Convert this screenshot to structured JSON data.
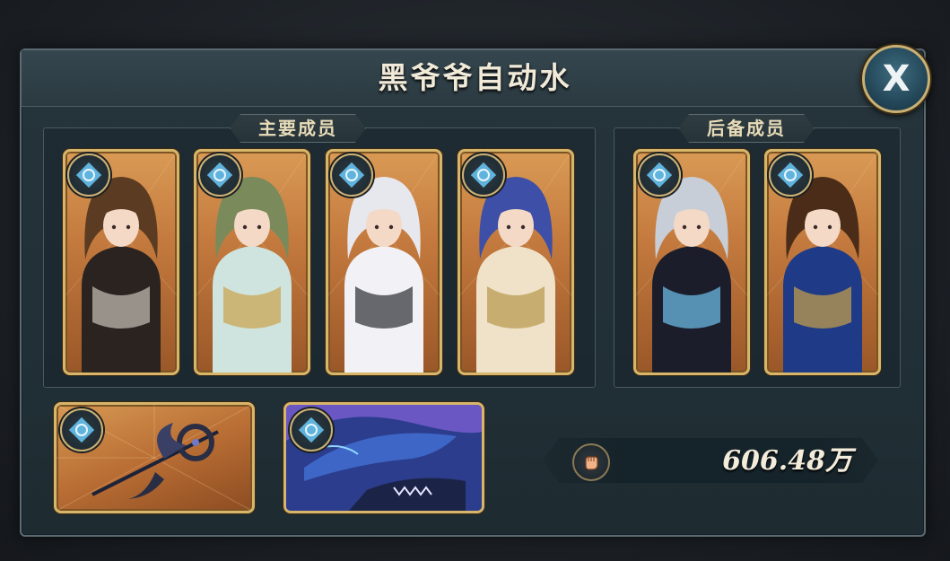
{
  "title": "黑爷爷自动水",
  "close_label": "X",
  "main_group": {
    "label": "主要成员",
    "members": [
      {
        "name": "brown-hair-knight-girl",
        "hair": "#5b3b22",
        "outfit": "#2a2320",
        "accent": "#c9c2b8"
      },
      {
        "name": "elf-green-hair-girl",
        "hair": "#7a8a5a",
        "outfit": "#cfe4df",
        "accent": "#c9a24a"
      },
      {
        "name": "white-hair-girl",
        "hair": "#e7e7ee",
        "outfit": "#f2f1f6",
        "accent": "#2c2c34"
      },
      {
        "name": "blue-hair-girl",
        "hair": "#3d4fa6",
        "outfit": "#efe2c8",
        "accent": "#b8974c"
      }
    ]
  },
  "reserve_group": {
    "label": "后备成员",
    "members": [
      {
        "name": "silver-hair-woman",
        "hair": "#c8ced8",
        "outfit": "#1b1d2b",
        "accent": "#6fc3f0"
      },
      {
        "name": "brown-hair-man",
        "hair": "#4a2c18",
        "outfit": "#1f3a86",
        "accent": "#c9a24a"
      }
    ]
  },
  "equipment": [
    {
      "name": "dark-scythe-weapon",
      "color": "#2a2e44"
    },
    {
      "name": "blue-sea-beast",
      "color": "#2b3d8c"
    }
  ],
  "power": {
    "value": "606.48万",
    "icon": "fist-icon"
  },
  "badge_icon": "swirl-element-icon",
  "colors": {
    "gold": "#d7b56a",
    "badge_blue": "#5fb3dc"
  }
}
